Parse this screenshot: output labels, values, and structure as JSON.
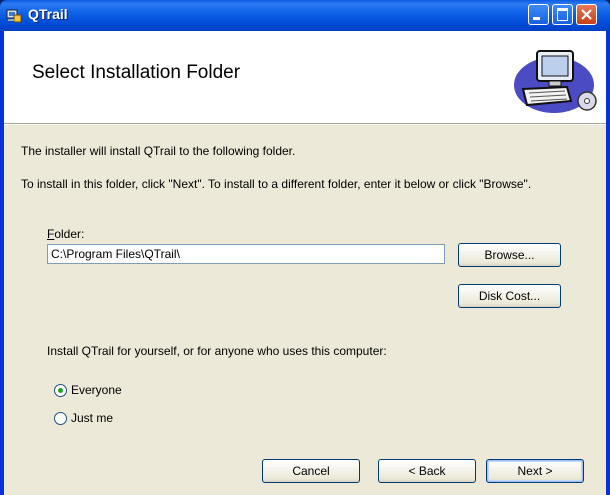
{
  "window": {
    "title": "QTrail"
  },
  "banner": {
    "title": "Select Installation Folder",
    "icon": "setup-computer-icon"
  },
  "body": {
    "intro": "The installer will install QTrail to the following folder.",
    "instructions": "To install in this folder, click \"Next\". To install to a different folder, enter it below or click \"Browse\".",
    "folder_label": "Folder:",
    "folder_value": "C:\\Program Files\\QTrail\\",
    "browse_label": "Browse...",
    "disk_cost_label": "Disk Cost...",
    "scope_question": "Install QTrail for yourself, or for anyone who uses this computer:",
    "scope_options": [
      {
        "label": "Everyone",
        "selected": true
      },
      {
        "label": "Just me",
        "selected": false
      }
    ]
  },
  "footer": {
    "cancel_label": "Cancel",
    "back_label": "< Back",
    "next_label": "Next >"
  },
  "colors": {
    "titlebar": "#0054e3",
    "client": "#ece9d8",
    "radio_dot": "#21a121"
  }
}
